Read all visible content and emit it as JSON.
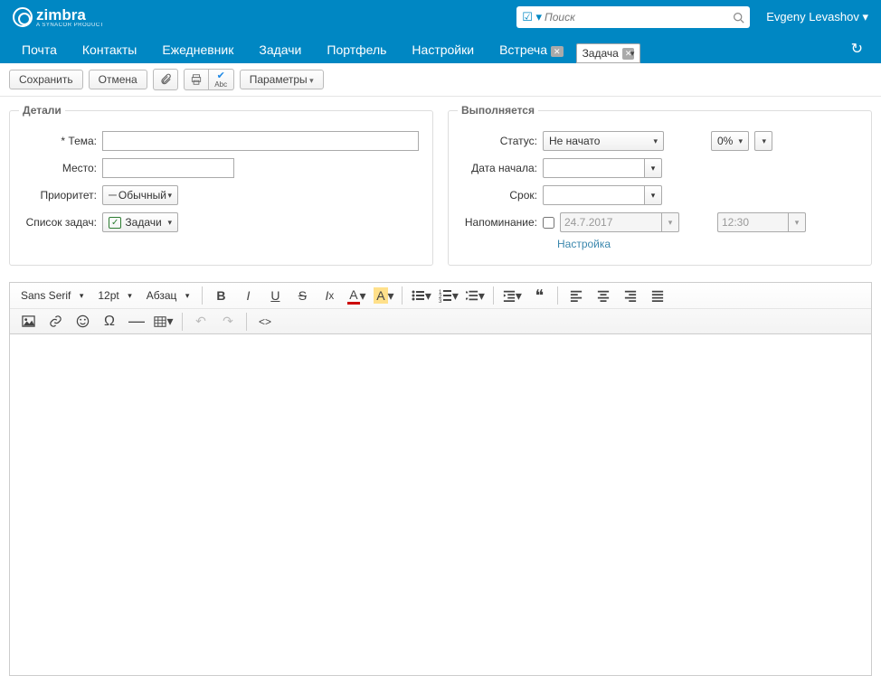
{
  "header": {
    "brand": "zimbra",
    "brand_sub": "A SYNACOR PRODUCT",
    "search_placeholder": "Поиск",
    "user": "Evgeny Levashov"
  },
  "nav": {
    "tabs": [
      "Почта",
      "Контакты",
      "Ежедневник",
      "Задачи",
      "Портфель",
      "Настройки"
    ],
    "extra": [
      {
        "label": "Встреча",
        "closable": true
      },
      {
        "label": "Задача",
        "closable": true,
        "selected": true
      }
    ]
  },
  "toolbar": {
    "save": "Сохранить",
    "cancel": "Отмена",
    "params": "Параметры"
  },
  "details": {
    "legend": "Детали",
    "subject_label": "* Тема:",
    "location_label": "Место:",
    "priority_label": "Приоритет:",
    "priority_value": "Обычный",
    "tasklist_label": "Список задач:",
    "tasklist_value": "Задачи"
  },
  "progress": {
    "legend": "Выполняется",
    "status_label": "Статус:",
    "status_value": "Не начато",
    "percent": "0%",
    "startdate_label": "Дата начала:",
    "due_label": "Срок:",
    "reminder_label": "Напоминание:",
    "reminder_date": "24.7.2017",
    "reminder_time": "12:30",
    "setup": "Настройка"
  },
  "editor": {
    "font": "Sans Serif",
    "size": "12pt",
    "para": "Абзац"
  }
}
